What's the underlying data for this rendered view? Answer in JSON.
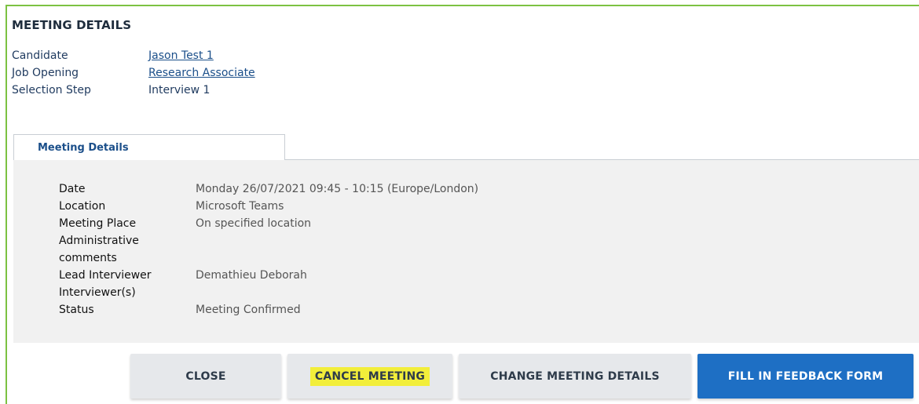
{
  "header": {
    "title": "MEETING DETAILS"
  },
  "summary": [
    {
      "label": "Candidate",
      "value": "Jason Test 1"
    },
    {
      "label": "Job Opening",
      "value": "Research Associate"
    },
    {
      "label": "Selection Step",
      "value": "Interview 1"
    }
  ],
  "tabs": [
    {
      "label": "Meeting Details",
      "active": true
    }
  ],
  "details": [
    {
      "label": "Date",
      "value": "Monday 26/07/2021 09:45 - 10:15 (Europe/London)"
    },
    {
      "label": "Location",
      "value": "Microsoft Teams"
    },
    {
      "label": "Meeting Place",
      "value": "On specified location"
    },
    {
      "label": "Administrative comments",
      "value": ""
    },
    {
      "label": "Lead Interviewer",
      "value": "Demathieu Deborah"
    },
    {
      "label": "Interviewer(s)",
      "value": ""
    },
    {
      "label": "Status",
      "value": "Meeting Confirmed"
    }
  ],
  "buttons": {
    "close": "CLOSE",
    "cancel_meeting": "CANCEL MEETING",
    "change_meeting_details": "CHANGE MEETING DETAILS",
    "fill_feedback_form": "FILL IN FEEDBACK FORM"
  },
  "colors": {
    "frame_border": "#7cc242",
    "link": "#1b4f8a",
    "primary_button": "#1e6fc4",
    "highlight": "#f2ee3a",
    "panel_background": "#f1f1f1"
  }
}
